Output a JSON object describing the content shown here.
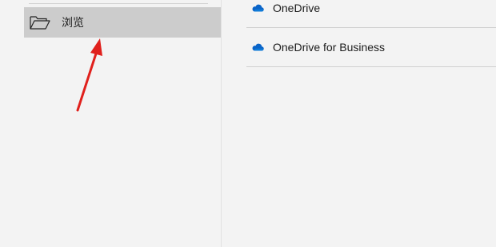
{
  "nav": {
    "browse_label": "浏览",
    "browse_icon": "folder-open-icon",
    "selected_background": "#cccccc"
  },
  "providers": [
    {
      "label": "OneDrive",
      "icon": "onedrive-cloud-icon"
    },
    {
      "label": "OneDrive for Business",
      "icon": "onedrive-cloud-icon"
    }
  ],
  "colors": {
    "background": "#f3f3f3",
    "cloud": "#0a64c8",
    "annotation_arrow": "#e0201c"
  }
}
